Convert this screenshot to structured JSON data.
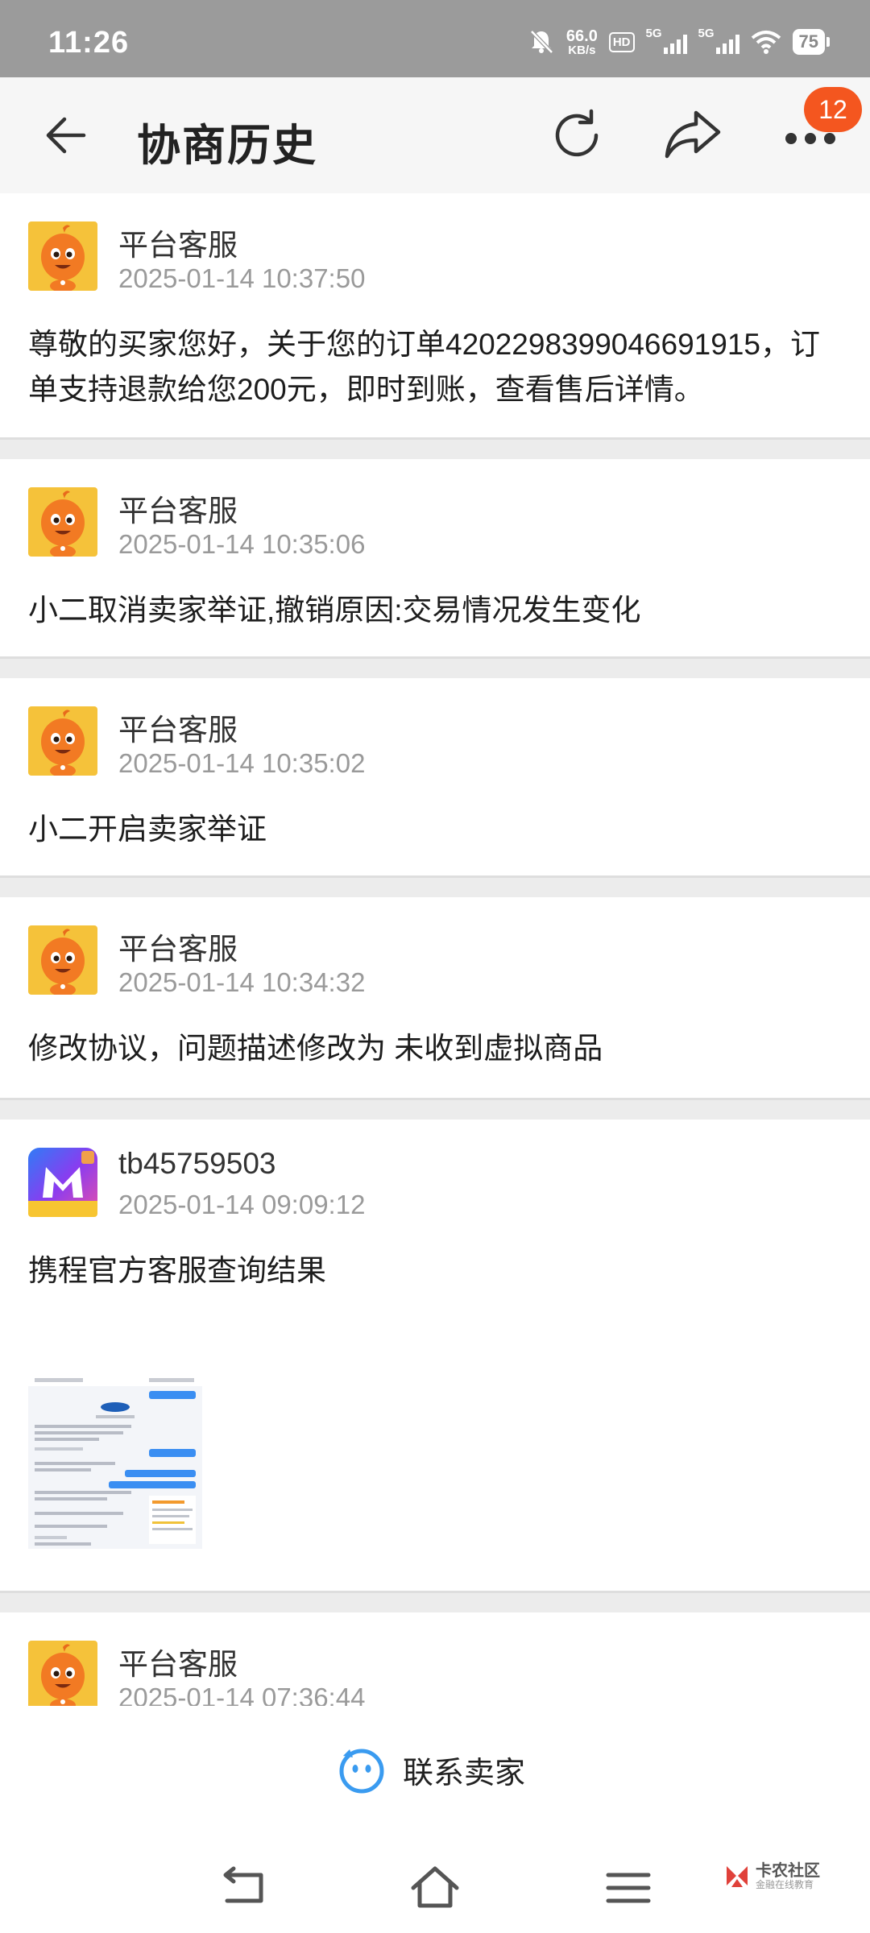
{
  "status_bar": {
    "time": "11:26",
    "net_speed_value": "66.0",
    "net_speed_unit": "KB/s",
    "hd_label": "HD",
    "sim_labels": [
      "5G",
      "5G"
    ],
    "battery": "75"
  },
  "header": {
    "title": "协商历史",
    "notification_count": "12"
  },
  "entries": [
    {
      "author": "平台客服",
      "time": "2025-01-14 10:37:50",
      "content": "尊敬的买家您好，关于您的订单4202298399046691915，订单支持退款给您200元，即时到账，查看售后详情。",
      "avatar": "orange-mascot"
    },
    {
      "author": "平台客服",
      "time": "2025-01-14 10:35:06",
      "content": "小二取消卖家举证,撤销原因:交易情况发生变化",
      "avatar": "orange-mascot"
    },
    {
      "author": "平台客服",
      "time": "2025-01-14 10:35:02",
      "content": "小二开启卖家举证",
      "avatar": "orange-mascot"
    },
    {
      "author": "平台客服",
      "time": "2025-01-14 10:34:32",
      "content": "修改协议，问题描述修改为  未收到虚拟商品",
      "avatar": "orange-mascot"
    },
    {
      "author": "tb45759503",
      "time": "2025-01-14 09:09:12",
      "content": "携程官方客服查询结果",
      "avatar": "purple-m-logo",
      "has_attachment": true
    },
    {
      "author": "平台客服",
      "time": "2025-01-14 07:36:44",
      "content": "",
      "avatar": "orange-mascot"
    }
  ],
  "bottom_action": {
    "contact_label": "联系卖家"
  },
  "watermark": {
    "main": "卡农社区",
    "sub": "金融在线教育"
  },
  "colors": {
    "accent_badge": "#f4561f",
    "contact_icon": "#3a9bf0"
  }
}
